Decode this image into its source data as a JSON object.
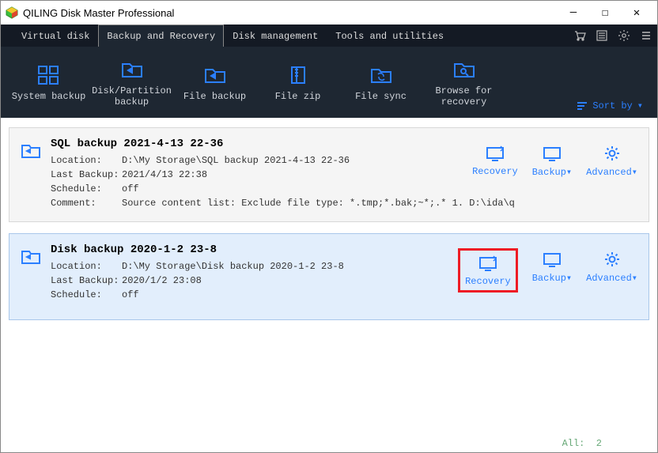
{
  "app": {
    "title": "QILING Disk Master Professional"
  },
  "tabs": [
    "Virtual disk",
    "Backup and Recovery",
    "Disk management",
    "Tools and utilities"
  ],
  "activeTabIndex": 1,
  "toolbar": {
    "items": [
      {
        "label": "System backup"
      },
      {
        "label": "Disk/Partition backup"
      },
      {
        "label": "File backup"
      },
      {
        "label": "File zip"
      },
      {
        "label": "File sync"
      },
      {
        "label": "Browse for recovery"
      }
    ],
    "sortLabel": "Sort by"
  },
  "cards": [
    {
      "title": "SQL backup 2021-4-13 22-36",
      "location_label": "Location:",
      "location": "D:\\My Storage\\SQL backup 2021-4-13 22-36",
      "last_label": "Last Backup:",
      "last": "2021/4/13 22:38",
      "schedule_label": "Schedule:",
      "schedule": "off",
      "comment_label": "Comment:",
      "comment": "Source content list:  Exclude file type: *.tmp;*.bak;~*;.*      1. D:\\ida\\q",
      "actions": {
        "recovery": "Recovery",
        "backup": "Backup▾",
        "advanced": "Advanced▾"
      }
    },
    {
      "title": "Disk backup 2020-1-2 23-8",
      "location_label": "Location:",
      "location": "D:\\My Storage\\Disk backup 2020-1-2 23-8",
      "last_label": "Last Backup:",
      "last": "2020/1/2 23:08",
      "schedule_label": "Schedule:",
      "schedule": "off",
      "actions": {
        "recovery": "Recovery",
        "backup": "Backup▾",
        "advanced": "Advanced▾"
      }
    }
  ],
  "status": {
    "all_label": "All:",
    "all_count": "2"
  }
}
